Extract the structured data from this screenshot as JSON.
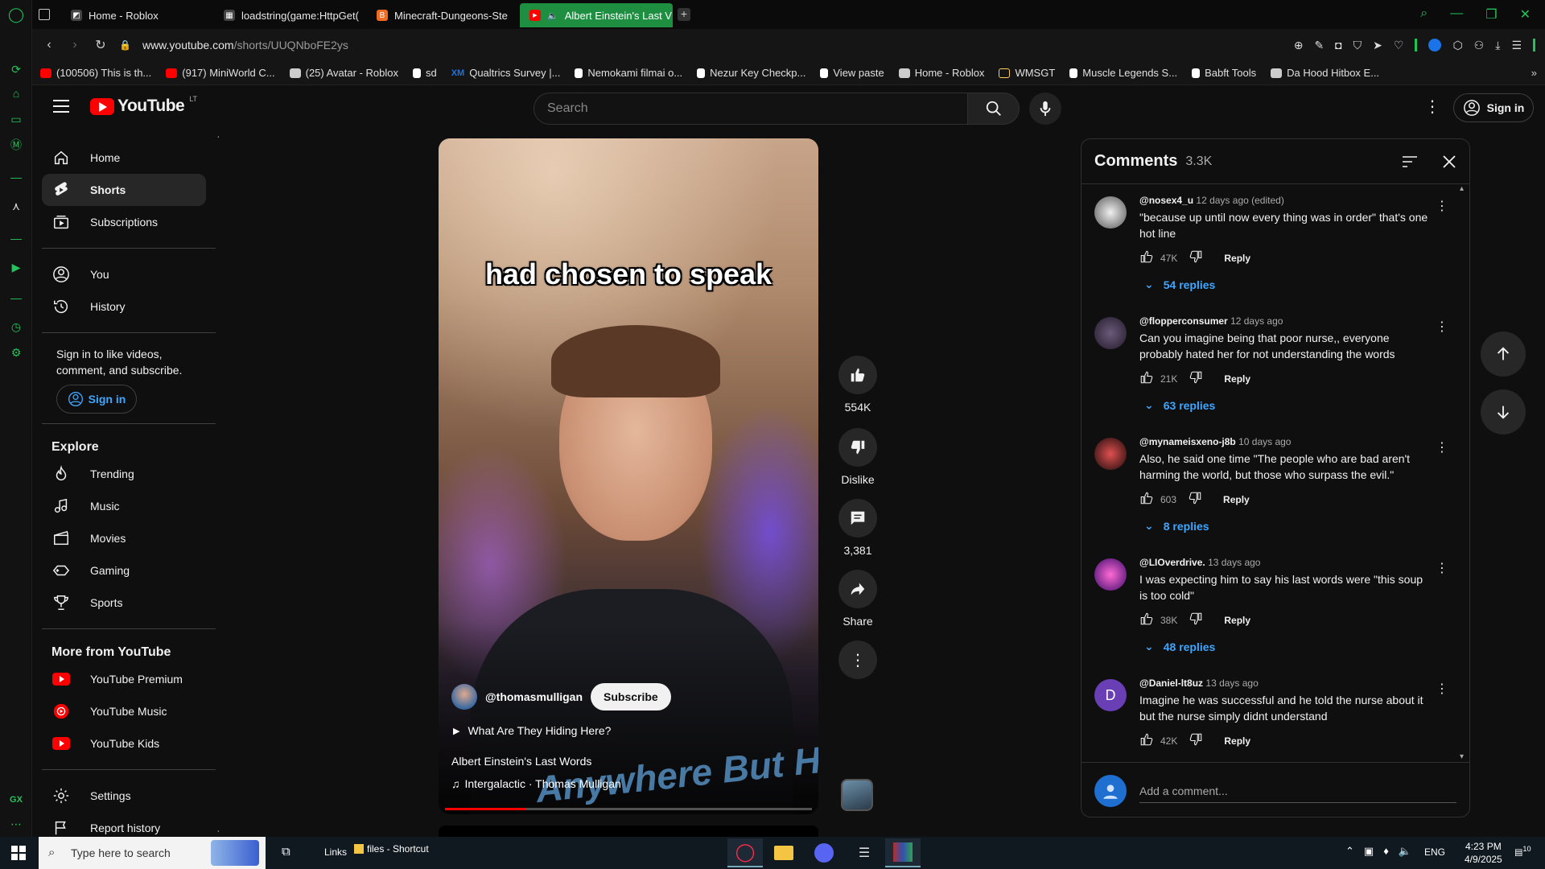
{
  "browser": {
    "tabs": [
      {
        "label": "Home - Roblox",
        "fav_color": "#444444",
        "fav_char": "◩"
      },
      {
        "label": "loadstring(game:HttpGet(",
        "fav_color": "#444444",
        "fav_char": "▦"
      },
      {
        "label": "Minecraft-Dungeons-Ste",
        "fav_color": "#f26b21",
        "fav_char": "B"
      },
      {
        "label": "Albert Einstein's Last V",
        "fav_color": "#ff0000",
        "fav_char": "▶"
      }
    ],
    "new_tab": "+",
    "url_host": "www.youtube.com",
    "url_path": "/shorts/UUQNboFE2ys",
    "accent": "#21c45b",
    "bookmarks": [
      {
        "label": "(100506) This is th...",
        "color": "#ff0000"
      },
      {
        "label": "(917) MiniWorld C...",
        "color": "#ff0000"
      },
      {
        "label": "(25) Avatar - Roblox",
        "color": "#cccccc"
      },
      {
        "label": "sd",
        "color": "#ffffff"
      },
      {
        "label": "Qualtrics Survey |...",
        "color": "#1a73e8",
        "prefix": "XM"
      },
      {
        "label": "Nemokami filmai o...",
        "color": "#ffffff"
      },
      {
        "label": "Nezur Key Checkp...",
        "color": "#ffffff"
      },
      {
        "label": "View paste",
        "color": "#ffffff"
      },
      {
        "label": "Home - Roblox",
        "color": "#cccccc"
      },
      {
        "label": "WMSGT",
        "color": "#ffcc55"
      },
      {
        "label": "Muscle Legends S...",
        "color": "#ffffff"
      },
      {
        "label": "Babft Tools",
        "color": "#ffffff"
      },
      {
        "label": "Da Hood Hitbox E...",
        "color": "#cccccc"
      }
    ]
  },
  "youtube": {
    "logo_text": "YouTube",
    "logo_region": "LT",
    "search_placeholder": "Search",
    "sign_in": "Sign in",
    "sidebar": {
      "main": [
        {
          "label": "Home",
          "icon": "home-icon"
        },
        {
          "label": "Shorts",
          "icon": "shorts-icon",
          "selected": true
        },
        {
          "label": "Subscriptions",
          "icon": "subscriptions-icon"
        }
      ],
      "you": [
        {
          "label": "You",
          "icon": "you-icon"
        },
        {
          "label": "History",
          "icon": "history-icon"
        }
      ],
      "signin_prompt": "Sign in to like videos, comment, and subscribe.",
      "signin_button": "Sign in",
      "explore_title": "Explore",
      "explore": [
        {
          "label": "Trending",
          "icon": "trending-icon"
        },
        {
          "label": "Music",
          "icon": "music-icon"
        },
        {
          "label": "Movies",
          "icon": "movies-icon"
        },
        {
          "label": "Gaming",
          "icon": "gaming-icon"
        },
        {
          "label": "Sports",
          "icon": "sports-icon"
        }
      ],
      "more_title": "More from YouTube",
      "more": [
        {
          "label": "YouTube Premium",
          "icon": "youtube-premium-icon"
        },
        {
          "label": "YouTube Music",
          "icon": "youtube-music-icon"
        },
        {
          "label": "YouTube Kids",
          "icon": "youtube-kids-icon"
        }
      ],
      "bottom": [
        {
          "label": "Settings",
          "icon": "settings-icon"
        },
        {
          "label": "Report history",
          "icon": "report-history-icon"
        }
      ]
    },
    "short": {
      "caption": "had chosen to speak",
      "channel": "@thomasmulligan",
      "subscribe": "Subscribe",
      "playlist": "What Are They Hiding Here?",
      "title": "Albert Einstein's Last Words",
      "music": "Intergalactic · Thomas Mulligan",
      "watermark": "Anywhere But Here",
      "progress": 0.22
    },
    "actions": {
      "likes": "554K",
      "dislike": "Dislike",
      "comments": "3,381",
      "share": "Share"
    },
    "comments": {
      "title": "Comments",
      "count": "3.3K",
      "reply_label": "Reply",
      "items": [
        {
          "author": "@nosex4_u",
          "time": "12 days ago (edited)",
          "text": "\"because up until now every thing was in order\" that's one hot line",
          "likes": "47K",
          "replies": "54 replies",
          "avatar": "#cfcfcf"
        },
        {
          "author": "@flopperconsumer",
          "time": "12 days ago",
          "text": "Can you imagine being that poor nurse,, everyone probably hated her for not understanding the words",
          "likes": "21K",
          "replies": "63 replies",
          "avatar": "#4a3a5a"
        },
        {
          "author": "@mynameisxeno-j8b",
          "time": "10 days ago",
          "text": "Also, he said one time \"The people who are bad aren't harming the world, but those who surpass the evil.\"",
          "likes": "603",
          "replies": "8 replies",
          "avatar": "#8a1a1a"
        },
        {
          "author": "@LIOverdrive.",
          "time": "13 days ago",
          "text": "I was expecting him to say his last words were \"this soup is too cold\"",
          "likes": "38K",
          "replies": "48 replies",
          "avatar": "#c02a7a"
        },
        {
          "author": "@Daniel-lt8uz",
          "time": "13 days ago",
          "text": "Imagine he was successful and he told the nurse about it but the nurse simply didnt understand",
          "likes": "42K",
          "replies": "",
          "avatar": "#6a3fb5",
          "initial": "D"
        }
      ],
      "add_placeholder": "Add a comment..."
    }
  },
  "taskbar": {
    "search_placeholder": "Type here to search",
    "links": "Links",
    "files": "files - Shortcut",
    "lang": "ENG",
    "time": "4:23 PM",
    "date": "4/9/2025",
    "notif": "10"
  }
}
